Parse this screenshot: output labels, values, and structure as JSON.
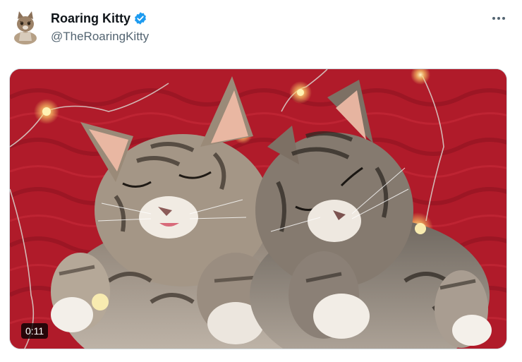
{
  "author": {
    "display_name": "Roaring Kitty",
    "handle": "@TheRoaringKitty",
    "verified": true,
    "avatar_icon": "kitten-avatar",
    "verified_icon": "verified-badge-icon",
    "verified_color": "#1d9bf0"
  },
  "menu": {
    "more_icon": "more-horizontal-icon"
  },
  "media": {
    "type": "video",
    "duration": "0:11",
    "description_icon": "two-sleeping-kittens-on-red-knit-blanket-with-fairy-lights"
  }
}
